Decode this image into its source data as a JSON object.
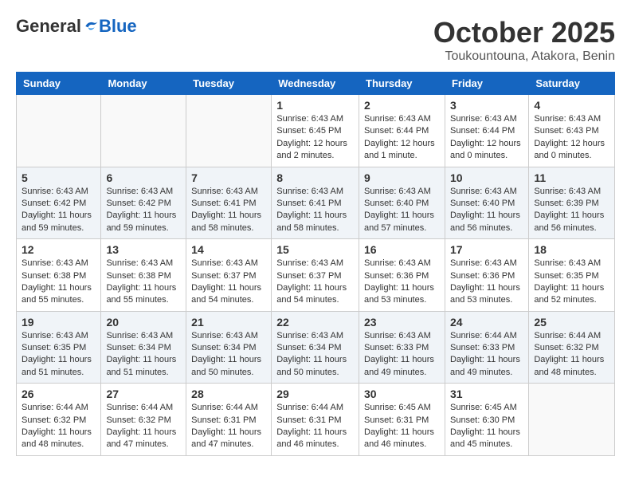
{
  "header": {
    "logo_general": "General",
    "logo_blue": "Blue",
    "month_title": "October 2025",
    "subtitle": "Toukountouna, Atakora, Benin"
  },
  "weekdays": [
    "Sunday",
    "Monday",
    "Tuesday",
    "Wednesday",
    "Thursday",
    "Friday",
    "Saturday"
  ],
  "weeks": [
    [
      {
        "day": "",
        "info": ""
      },
      {
        "day": "",
        "info": ""
      },
      {
        "day": "",
        "info": ""
      },
      {
        "day": "1",
        "info": "Sunrise: 6:43 AM\nSunset: 6:45 PM\nDaylight: 12 hours\nand 2 minutes."
      },
      {
        "day": "2",
        "info": "Sunrise: 6:43 AM\nSunset: 6:44 PM\nDaylight: 12 hours\nand 1 minute."
      },
      {
        "day": "3",
        "info": "Sunrise: 6:43 AM\nSunset: 6:44 PM\nDaylight: 12 hours\nand 0 minutes."
      },
      {
        "day": "4",
        "info": "Sunrise: 6:43 AM\nSunset: 6:43 PM\nDaylight: 12 hours\nand 0 minutes."
      }
    ],
    [
      {
        "day": "5",
        "info": "Sunrise: 6:43 AM\nSunset: 6:42 PM\nDaylight: 11 hours\nand 59 minutes."
      },
      {
        "day": "6",
        "info": "Sunrise: 6:43 AM\nSunset: 6:42 PM\nDaylight: 11 hours\nand 59 minutes."
      },
      {
        "day": "7",
        "info": "Sunrise: 6:43 AM\nSunset: 6:41 PM\nDaylight: 11 hours\nand 58 minutes."
      },
      {
        "day": "8",
        "info": "Sunrise: 6:43 AM\nSunset: 6:41 PM\nDaylight: 11 hours\nand 58 minutes."
      },
      {
        "day": "9",
        "info": "Sunrise: 6:43 AM\nSunset: 6:40 PM\nDaylight: 11 hours\nand 57 minutes."
      },
      {
        "day": "10",
        "info": "Sunrise: 6:43 AM\nSunset: 6:40 PM\nDaylight: 11 hours\nand 56 minutes."
      },
      {
        "day": "11",
        "info": "Sunrise: 6:43 AM\nSunset: 6:39 PM\nDaylight: 11 hours\nand 56 minutes."
      }
    ],
    [
      {
        "day": "12",
        "info": "Sunrise: 6:43 AM\nSunset: 6:38 PM\nDaylight: 11 hours\nand 55 minutes."
      },
      {
        "day": "13",
        "info": "Sunrise: 6:43 AM\nSunset: 6:38 PM\nDaylight: 11 hours\nand 55 minutes."
      },
      {
        "day": "14",
        "info": "Sunrise: 6:43 AM\nSunset: 6:37 PM\nDaylight: 11 hours\nand 54 minutes."
      },
      {
        "day": "15",
        "info": "Sunrise: 6:43 AM\nSunset: 6:37 PM\nDaylight: 11 hours\nand 54 minutes."
      },
      {
        "day": "16",
        "info": "Sunrise: 6:43 AM\nSunset: 6:36 PM\nDaylight: 11 hours\nand 53 minutes."
      },
      {
        "day": "17",
        "info": "Sunrise: 6:43 AM\nSunset: 6:36 PM\nDaylight: 11 hours\nand 53 minutes."
      },
      {
        "day": "18",
        "info": "Sunrise: 6:43 AM\nSunset: 6:35 PM\nDaylight: 11 hours\nand 52 minutes."
      }
    ],
    [
      {
        "day": "19",
        "info": "Sunrise: 6:43 AM\nSunset: 6:35 PM\nDaylight: 11 hours\nand 51 minutes."
      },
      {
        "day": "20",
        "info": "Sunrise: 6:43 AM\nSunset: 6:34 PM\nDaylight: 11 hours\nand 51 minutes."
      },
      {
        "day": "21",
        "info": "Sunrise: 6:43 AM\nSunset: 6:34 PM\nDaylight: 11 hours\nand 50 minutes."
      },
      {
        "day": "22",
        "info": "Sunrise: 6:43 AM\nSunset: 6:34 PM\nDaylight: 11 hours\nand 50 minutes."
      },
      {
        "day": "23",
        "info": "Sunrise: 6:43 AM\nSunset: 6:33 PM\nDaylight: 11 hours\nand 49 minutes."
      },
      {
        "day": "24",
        "info": "Sunrise: 6:44 AM\nSunset: 6:33 PM\nDaylight: 11 hours\nand 49 minutes."
      },
      {
        "day": "25",
        "info": "Sunrise: 6:44 AM\nSunset: 6:32 PM\nDaylight: 11 hours\nand 48 minutes."
      }
    ],
    [
      {
        "day": "26",
        "info": "Sunrise: 6:44 AM\nSunset: 6:32 PM\nDaylight: 11 hours\nand 48 minutes."
      },
      {
        "day": "27",
        "info": "Sunrise: 6:44 AM\nSunset: 6:32 PM\nDaylight: 11 hours\nand 47 minutes."
      },
      {
        "day": "28",
        "info": "Sunrise: 6:44 AM\nSunset: 6:31 PM\nDaylight: 11 hours\nand 47 minutes."
      },
      {
        "day": "29",
        "info": "Sunrise: 6:44 AM\nSunset: 6:31 PM\nDaylight: 11 hours\nand 46 minutes."
      },
      {
        "day": "30",
        "info": "Sunrise: 6:45 AM\nSunset: 6:31 PM\nDaylight: 11 hours\nand 46 minutes."
      },
      {
        "day": "31",
        "info": "Sunrise: 6:45 AM\nSunset: 6:30 PM\nDaylight: 11 hours\nand 45 minutes."
      },
      {
        "day": "",
        "info": ""
      }
    ]
  ]
}
